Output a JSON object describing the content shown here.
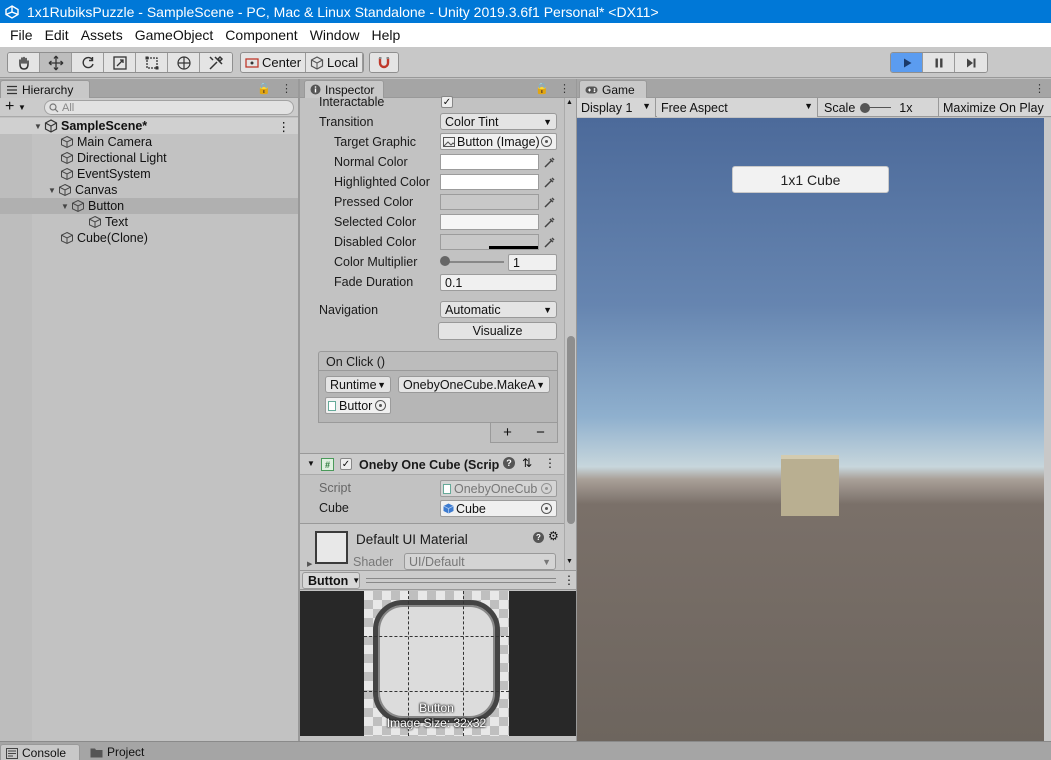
{
  "window": {
    "title": "1x1RubiksPuzzle - SampleScene - PC, Mac & Linux Standalone - Unity 2019.3.6f1 Personal* <DX11>"
  },
  "menu": [
    "File",
    "Edit",
    "Assets",
    "GameObject",
    "Component",
    "Window",
    "Help"
  ],
  "toolbar": {
    "pivot_label": "Center",
    "space_label": "Local"
  },
  "hierarchy": {
    "tab": "Hierarchy",
    "add_label": "+",
    "search_placeholder": "All",
    "scene": "SampleScene*",
    "items": [
      "Main Camera",
      "Directional Light",
      "EventSystem",
      "Canvas",
      "Button",
      "Text",
      "Cube(Clone)"
    ]
  },
  "inspector": {
    "tab": "Inspector",
    "interactable_label": "Interactable",
    "transition_label": "Transition",
    "transition_value": "Color Tint",
    "target_graphic_label": "Target Graphic",
    "target_graphic_value": "Button (Image)",
    "normal_color_label": "Normal Color",
    "highlighted_color_label": "Highlighted Color",
    "pressed_color_label": "Pressed Color",
    "selected_color_label": "Selected Color",
    "disabled_color_label": "Disabled Color",
    "color_multiplier_label": "Color Multiplier",
    "color_multiplier_value": "1",
    "fade_duration_label": "Fade Duration",
    "fade_duration_value": "0.1",
    "navigation_label": "Navigation",
    "navigation_value": "Automatic",
    "visualize_label": "Visualize",
    "onclick_header": "On Click ()",
    "onclick_runtime": "Runtime",
    "onclick_function": "OnebyOneCube.MakeA",
    "onclick_object": "Buttor",
    "plus_label": "+",
    "minus_label": "−",
    "script_component_title": "Oneby One Cube (Scrip",
    "script_label": "Script",
    "script_value": "OnebyOneCub",
    "cube_label": "Cube",
    "cube_value": "Cube",
    "material_title": "Default UI Material",
    "shader_label": "Shader",
    "shader_value": "UI/Default",
    "preview_title": "Button",
    "preview_caption": "Button",
    "preview_size": "Image Size: 32x32"
  },
  "game": {
    "tab": "Game",
    "display": "Display 1",
    "aspect": "Free Aspect",
    "scale_label": "Scale",
    "scale_value": "1x",
    "maximize": "Maximize On Play",
    "ui_button": "1x1 Cube"
  },
  "bottom": {
    "console_tab": "Console",
    "project_tab": "Project"
  },
  "colors": {
    "titlebar": "#0078d7",
    "play_active": "#5b9cf0",
    "game_floor": "#6d655e",
    "cube": "#bcb293"
  }
}
